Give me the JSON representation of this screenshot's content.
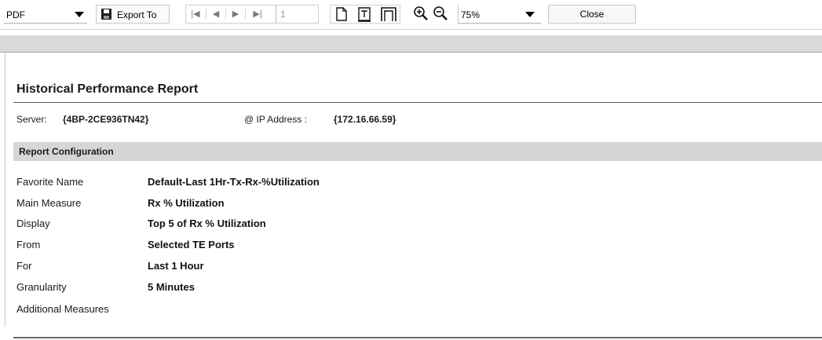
{
  "toolbar": {
    "format_value": "PDF",
    "export_label": "Export To",
    "page_number": "1",
    "zoom_value": "75%",
    "close_label": "Close"
  },
  "report": {
    "title": "Historical Performance Report",
    "server_label": "Server:",
    "server_value": "{4BP-2CE936TN42}",
    "ip_label": "@ IP Address :",
    "ip_value": "{172.16.66.59}",
    "config_heading": "Report Configuration",
    "config": [
      {
        "label": "Favorite Name",
        "value": "Default-Last 1Hr-Tx-Rx-%Utilization"
      },
      {
        "label": "Main Measure",
        "value": "Rx % Utilization"
      },
      {
        "label": "Display",
        "value": "Top 5 of Rx % Utilization"
      },
      {
        "label": "From",
        "value": "Selected  TE Ports"
      },
      {
        "label": "For",
        "value": "Last 1 Hour"
      },
      {
        "label": "Granularity",
        "value": "5 Minutes"
      },
      {
        "label": "Additional Measures",
        "value": ""
      }
    ]
  },
  "icons": [
    "floppy-disk-icon",
    "first-page-icon",
    "previous-page-icon",
    "next-page-icon",
    "last-page-icon",
    "single-page-icon",
    "page-with-header-icon",
    "page-with-margins-icon",
    "zoom-in-icon",
    "zoom-out-icon",
    "dropdown-arrow-icon"
  ],
  "colors": {
    "band": "#d6d6d6",
    "strip": "#d9d9d9",
    "rule": "#5a5a5a"
  }
}
